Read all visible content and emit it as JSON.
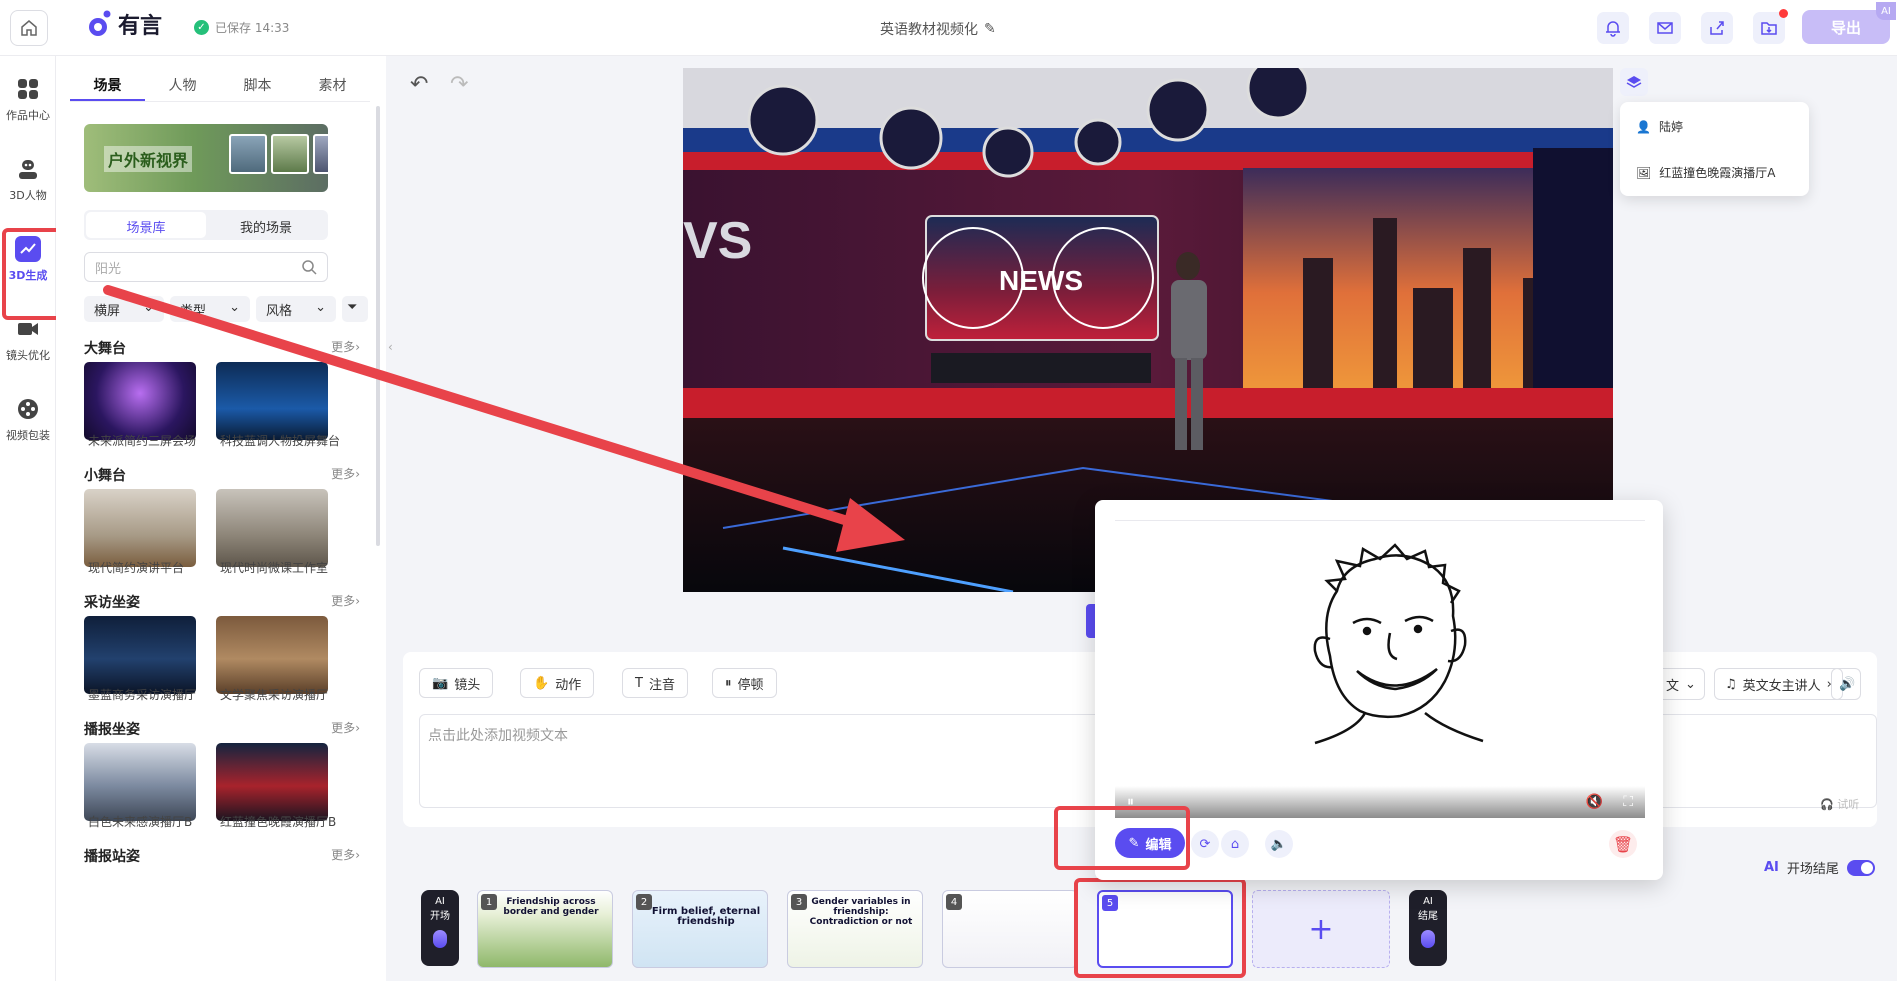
{
  "header": {
    "logo_text": "有言",
    "saved_text": "已保存 14:33",
    "doc_title": "英语教材视频化",
    "export_label": "导出",
    "ai_badge": "AI"
  },
  "nav": {
    "items": [
      {
        "label": "作品中心",
        "icon": "grid-icon"
      },
      {
        "label": "3D人物",
        "icon": "avatar-icon"
      },
      {
        "label": "3D生成",
        "icon": "chart-icon"
      },
      {
        "label": "镜头优化",
        "icon": "camera-icon"
      },
      {
        "label": "视频包装",
        "icon": "reel-icon"
      }
    ]
  },
  "panel": {
    "tabs": [
      "场景",
      "人物",
      "脚本",
      "素材"
    ],
    "banner_text": "户外新视界",
    "segment": [
      "场景库",
      "我的场景"
    ],
    "search_placeholder": "阳光",
    "filters": [
      "横屏",
      "类型",
      "风格"
    ],
    "more_label": "更多",
    "sections": [
      {
        "title": "大舞台",
        "cards": [
          "未来派简约三屏会场",
          "科技蓝调人物投屏舞台"
        ]
      },
      {
        "title": "小舞台",
        "cards": [
          "现代简约演讲平台",
          "现代时尚微课工作室"
        ]
      },
      {
        "title": "采访坐姿",
        "cards": [
          "墨蓝商务采访演播厅",
          "文学聚焦采访演播厅"
        ]
      },
      {
        "title": "播报坐姿",
        "cards": [
          "白色未来感演播厅B",
          "红蓝撞色晚霞演播厅B"
        ]
      },
      {
        "title": "播报站姿",
        "cards": []
      }
    ]
  },
  "stage": {
    "news_text": "NEWS",
    "side_text": "VS"
  },
  "layer_popup": {
    "items": [
      "陆婷",
      "红蓝撞色晚霞演播厅A"
    ]
  },
  "editor": {
    "tools": [
      "镜头",
      "动作",
      "注音",
      "停顿"
    ],
    "text_placeholder": "点击此处添加视频文本",
    "language_partial": "文",
    "voice_label": "英文女主讲人",
    "listen_label": "试听",
    "ai_toggle_label": "开场结尾"
  },
  "timeline": {
    "ai_start": [
      "AI",
      "开场"
    ],
    "ai_end": [
      "AI",
      "结尾"
    ],
    "slides": [
      {
        "num": "1",
        "title": "Friendship across border and gender"
      },
      {
        "num": "2",
        "title": "Firm belief, eternal friendship"
      },
      {
        "num": "3",
        "title": "Gender variables in friendship: Contradiction or not"
      },
      {
        "num": "4",
        "title": ""
      },
      {
        "num": "5",
        "title": ""
      }
    ],
    "add_label": "+"
  },
  "preview": {
    "edit_label": "编辑"
  }
}
